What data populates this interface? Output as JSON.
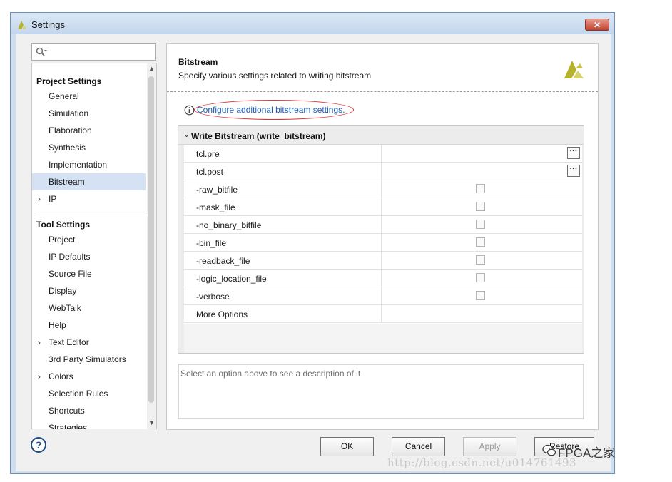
{
  "window": {
    "title": "Settings",
    "close_label": "✕"
  },
  "search": {
    "placeholder": ""
  },
  "sidebar": {
    "project_settings_header": "Project Settings",
    "project_items": [
      {
        "label": "General"
      },
      {
        "label": "Simulation"
      },
      {
        "label": "Elaboration"
      },
      {
        "label": "Synthesis"
      },
      {
        "label": "Implementation"
      },
      {
        "label": "Bitstream",
        "selected": true
      },
      {
        "label": "IP",
        "expandable": true
      }
    ],
    "tool_settings_header": "Tool Settings",
    "tool_items": [
      {
        "label": "Project"
      },
      {
        "label": "IP Defaults"
      },
      {
        "label": "Source File"
      },
      {
        "label": "Display"
      },
      {
        "label": "WebTalk"
      },
      {
        "label": "Help"
      },
      {
        "label": "Text Editor",
        "expandable": true
      },
      {
        "label": "3rd Party Simulators"
      },
      {
        "label": "Colors",
        "expandable": true
      },
      {
        "label": "Selection Rules"
      },
      {
        "label": "Shortcuts"
      },
      {
        "label": "Strategies"
      }
    ]
  },
  "main": {
    "title": "Bitstream",
    "subtitle": "Specify various settings related to writing bitstream",
    "config_link": "Configure additional bitstream settings.",
    "group_header": "Write Bitstream (write_bitstream)",
    "options": [
      {
        "label": "tcl.pre",
        "type": "browse"
      },
      {
        "label": "tcl.post",
        "type": "browse"
      },
      {
        "label": "-raw_bitfile",
        "type": "checkbox",
        "checked": false
      },
      {
        "label": "-mask_file",
        "type": "checkbox",
        "checked": false
      },
      {
        "label": "-no_binary_bitfile",
        "type": "checkbox",
        "checked": false
      },
      {
        "label": "-bin_file",
        "type": "checkbox",
        "checked": false
      },
      {
        "label": "-readback_file",
        "type": "checkbox",
        "checked": false
      },
      {
        "label": "-logic_location_file",
        "type": "checkbox",
        "checked": false
      },
      {
        "label": "-verbose",
        "type": "checkbox",
        "checked": false
      },
      {
        "label": "More Options",
        "type": "text"
      }
    ],
    "description_placeholder": "Select an option above to see a description of it"
  },
  "footer": {
    "help_label": "?",
    "ok_label": "OK",
    "cancel_label": "Cancel",
    "apply_label": "Apply",
    "restore_label": "Restore"
  },
  "watermark": {
    "url": "http://blog.csdn.net/u014761493",
    "brand": "FPGA之家"
  },
  "colors": {
    "accent": "#d4e2f3",
    "link": "#1c5fb8",
    "annotation": "#e03030",
    "logo": "#b6b22c"
  },
  "icons": [
    "xilinx-logo-icon",
    "search-icon",
    "info-icon",
    "help-icon",
    "chevron-right-icon",
    "chevron-down-icon",
    "wechat-icon"
  ]
}
